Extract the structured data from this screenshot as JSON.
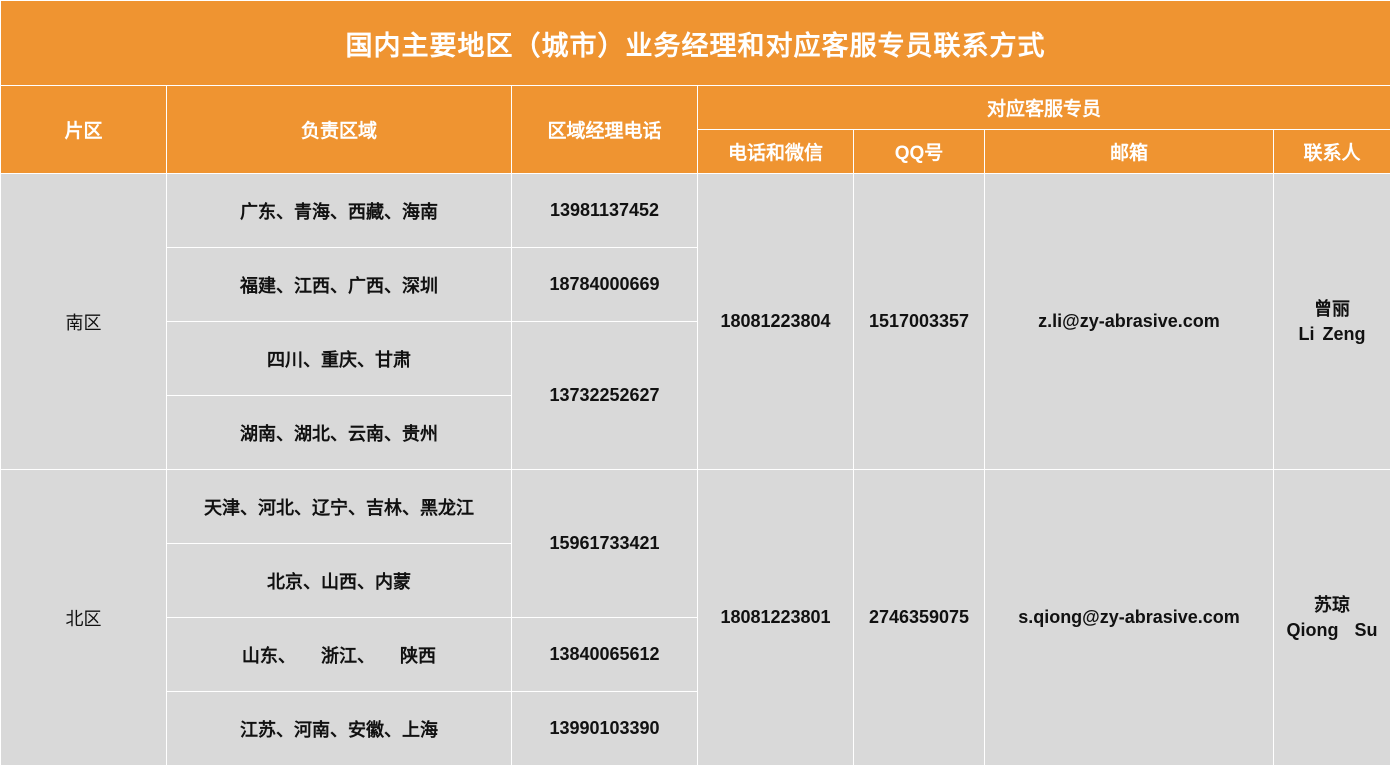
{
  "title": "国内主要地区（城市）业务经理和对应客服专员联系方式",
  "headers": {
    "region": "片区",
    "area": "负责区域",
    "manager_phone": "区域经理电话",
    "service_group": "对应客服专员",
    "phone_wechat": "电话和微信",
    "qq_prefix": "QQ",
    "qq_suffix": "号",
    "email": "邮箱",
    "contact": "联系人"
  },
  "south": {
    "region": "南区",
    "areas": [
      "广东、青海、西藏、海南",
      "福建、江西、广西、深圳",
      "四川、重庆、甘肃",
      "湖南、湖北、云南、贵州"
    ],
    "manager_phones": [
      "13981137452",
      "18784000669",
      "13732252627"
    ],
    "phone_wechat": "18081223804",
    "qq": "1517003357",
    "email": "z.li@zy-abrasive.com",
    "contact_cn": "曾丽",
    "contact_en": "Li Zeng"
  },
  "north": {
    "region": "北区",
    "areas": [
      "天津、河北、辽宁、吉林、黑龙江",
      "北京、山西、内蒙",
      "山东、    浙江、    陕西",
      "江苏、河南、安徽、上海"
    ],
    "manager_phones": [
      "15961733421",
      "13840065612",
      "13990103390"
    ],
    "phone_wechat": "18081223801",
    "qq": "2746359075",
    "email": "s.qiong@zy-abrasive.com",
    "contact_cn": "苏琼",
    "contact_en": "Qiong  Su"
  },
  "colors": {
    "header_orange": "#ef9431",
    "body_gray": "#d9d9d9",
    "header_text": "#ffffff"
  }
}
